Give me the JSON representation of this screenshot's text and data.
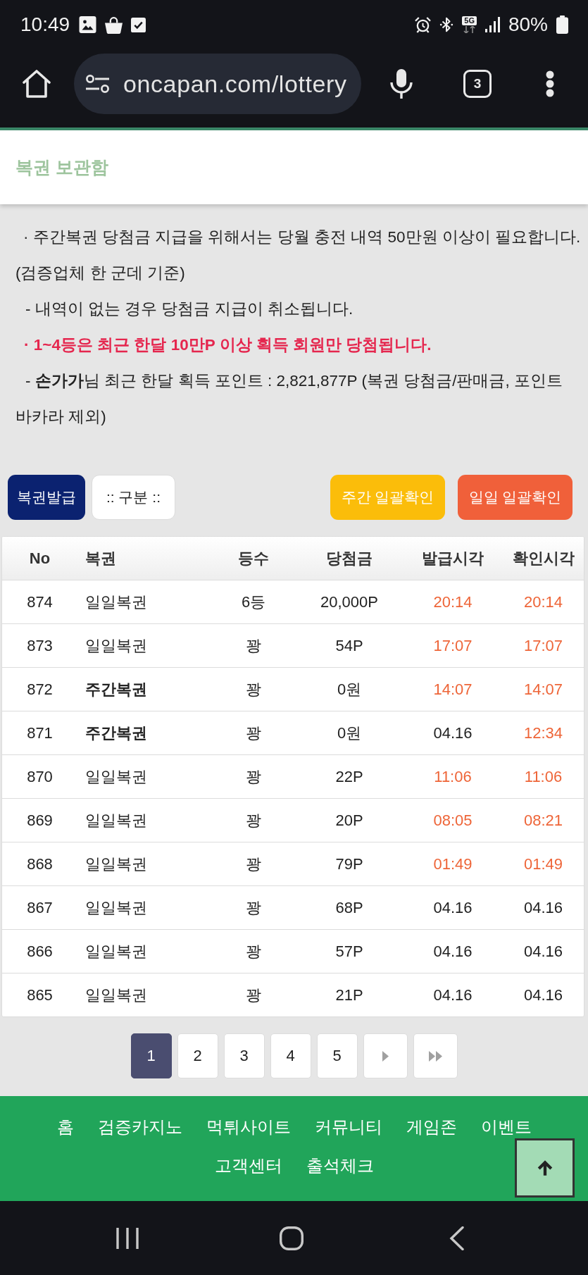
{
  "status_bar": {
    "time": "10:49",
    "network": "5G",
    "battery": "80%"
  },
  "browser": {
    "url": "oncapan.com/lottery",
    "tab_count": "3"
  },
  "header": {
    "title": "복권 보관함"
  },
  "notices": [
    {
      "kind": "dot",
      "text": "· 주간복권 당첨금 지급을 위해서는 당월 충전 내역 50만원 이상이 필요합니다. (검증업체 한 군데 기준)"
    },
    {
      "kind": "dash",
      "text": "- 내역이 없는 경우 당첨금 지급이 취소됩니다."
    },
    {
      "kind": "alert",
      "text": "· 1~4등은 최근 한달 10만P 이상 획득 회원만 당첨됩니다."
    },
    {
      "kind": "dash",
      "text": "- **손가가**님 최근 한달 획득 포인트 : 2,821,877P (복권 당첨금/판매금, 포인트 바카라 제외)"
    }
  ],
  "toolbar": {
    "issue_button": "복권발급",
    "category_select": {
      "value": ":: 구분 ::"
    },
    "actions": [
      {
        "label": "주간 일괄확인",
        "color": "#fbbd0a"
      },
      {
        "label": "일일 일괄확인",
        "color": "#f0603a"
      }
    ]
  },
  "table": {
    "columns": [
      "No",
      "복권",
      "등수",
      "당첨금",
      "발급시각",
      "확인시각"
    ],
    "rows": [
      {
        "no": "874",
        "kind": "daily",
        "lottery": "일일복권",
        "rank": "6등",
        "prize": "20,000P",
        "issued": {
          "text": "20:14",
          "highlighted": true
        },
        "confirmed": {
          "text": "20:14",
          "highlighted": true
        }
      },
      {
        "no": "873",
        "kind": "daily",
        "lottery": "일일복권",
        "rank": "꽝",
        "prize": "54P",
        "issued": {
          "text": "17:07",
          "highlighted": true
        },
        "confirmed": {
          "text": "17:07",
          "highlighted": true
        }
      },
      {
        "no": "872",
        "kind": "weekly",
        "lottery": "주간복권",
        "rank": "꽝",
        "prize": "0원",
        "issued": {
          "text": "14:07",
          "highlighted": true
        },
        "confirmed": {
          "text": "14:07",
          "highlighted": true
        }
      },
      {
        "no": "871",
        "kind": "weekly",
        "lottery": "주간복권",
        "rank": "꽝",
        "prize": "0원",
        "issued": {
          "text": "04.16",
          "highlighted": false
        },
        "confirmed": {
          "text": "12:34",
          "highlighted": true
        }
      },
      {
        "no": "870",
        "kind": "daily",
        "lottery": "일일복권",
        "rank": "꽝",
        "prize": "22P",
        "issued": {
          "text": "11:06",
          "highlighted": true
        },
        "confirmed": {
          "text": "11:06",
          "highlighted": true
        }
      },
      {
        "no": "869",
        "kind": "daily",
        "lottery": "일일복권",
        "rank": "꽝",
        "prize": "20P",
        "issued": {
          "text": "08:05",
          "highlighted": true
        },
        "confirmed": {
          "text": "08:21",
          "highlighted": true
        }
      },
      {
        "no": "868",
        "kind": "daily",
        "lottery": "일일복권",
        "rank": "꽝",
        "prize": "79P",
        "issued": {
          "text": "01:49",
          "highlighted": true
        },
        "confirmed": {
          "text": "01:49",
          "highlighted": true
        }
      },
      {
        "no": "867",
        "kind": "daily",
        "lottery": "일일복권",
        "rank": "꽝",
        "prize": "68P",
        "issued": {
          "text": "04.16",
          "highlighted": false
        },
        "confirmed": {
          "text": "04.16",
          "highlighted": false
        }
      },
      {
        "no": "866",
        "kind": "daily",
        "lottery": "일일복권",
        "rank": "꽝",
        "prize": "57P",
        "issued": {
          "text": "04.16",
          "highlighted": false
        },
        "confirmed": {
          "text": "04.16",
          "highlighted": false
        }
      },
      {
        "no": "865",
        "kind": "daily",
        "lottery": "일일복권",
        "rank": "꽝",
        "prize": "21P",
        "issued": {
          "text": "04.16",
          "highlighted": false
        },
        "confirmed": {
          "text": "04.16",
          "highlighted": false
        }
      }
    ]
  },
  "pagination": {
    "pages": [
      {
        "label": "1",
        "selected": true
      },
      {
        "label": "2",
        "selected": false
      },
      {
        "label": "3",
        "selected": false
      },
      {
        "label": "4",
        "selected": false
      },
      {
        "label": "5",
        "selected": false
      }
    ]
  },
  "footer": {
    "links": [
      "홈",
      "검증카지노",
      "먹튀사이트",
      "커뮤니티",
      "게임존",
      "이벤트",
      "고객센터",
      "출석체크"
    ]
  }
}
